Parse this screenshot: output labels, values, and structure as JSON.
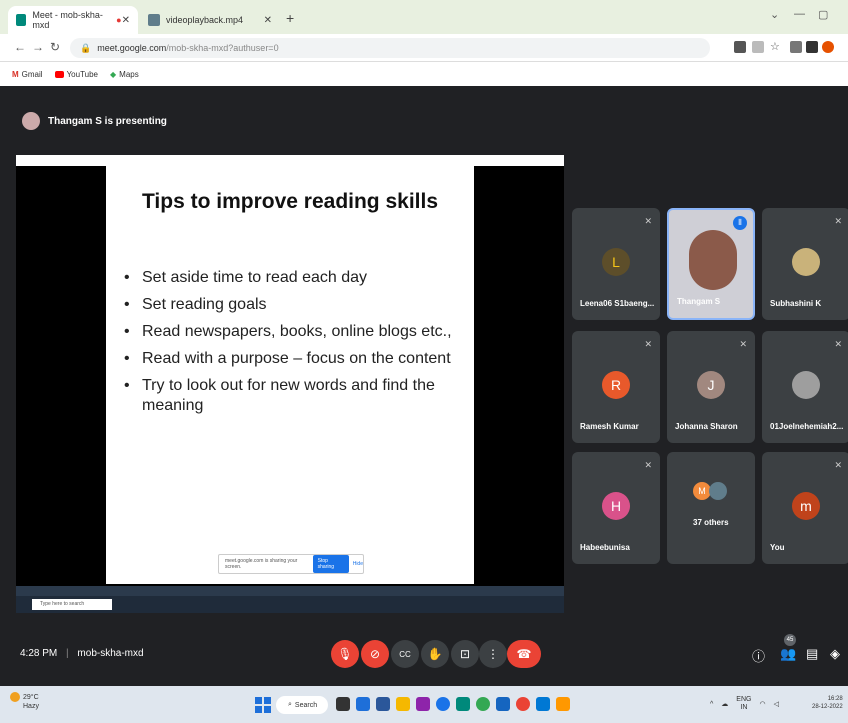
{
  "browser": {
    "tabs": [
      {
        "label": "Meet - mob-skha-mxd"
      },
      {
        "label": "videoplayback.mp4"
      }
    ],
    "url_host": "meet.google.com",
    "url_path": "/mob-skha-mxd?authuser=0",
    "bookmarks": [
      "Gmail",
      "YouTube",
      "Maps"
    ]
  },
  "meet": {
    "presenting_text": "Thangam S is presenting",
    "time": "4:28 PM",
    "meeting_code": "mob-skha-mxd",
    "participant_count": "45"
  },
  "slide": {
    "title": "Tips to improve reading skills",
    "bullets": [
      "Set aside time to read each day",
      "Set reading goals",
      "Read newspapers, books, online blogs etc.,",
      "Read with a purpose – focus on the content",
      "Try to look out for new words and find the meaning"
    ],
    "sharing_text": "meet.google.com is sharing your screen.",
    "stop_sharing": "Stop sharing",
    "hide": "Hide",
    "taskbar_search": "Type here to search"
  },
  "tiles": [
    {
      "name": "Leena06 S1baeng...",
      "initial": "L",
      "color": "#3c4043"
    },
    {
      "name": "Thangam S",
      "initial": "",
      "color": "#cfcfd6"
    },
    {
      "name": "Subhashini K",
      "initial": "",
      "color": "#3c4043"
    },
    {
      "name": "Ramesh Kumar",
      "initial": "R",
      "color": "#e8592b"
    },
    {
      "name": "Johanna Sharon",
      "initial": "J",
      "color": "#a1887f"
    },
    {
      "name": "01Joelnehemiah2...",
      "initial": "",
      "color": "#3c4043"
    },
    {
      "name": "Habeebunisa",
      "initial": "H",
      "color": "#d9528a"
    },
    {
      "name": "37 others",
      "initial": "M",
      "color": "#f28b3c"
    },
    {
      "name": "You",
      "initial": "m",
      "color": "#c0431b"
    }
  ],
  "taskbar": {
    "temp": "29°C",
    "weather": "Hazy",
    "search": "Search",
    "lang": "ENG",
    "lang2": "IN",
    "clock_time": "16:28",
    "clock_date": "28-12-2022"
  }
}
